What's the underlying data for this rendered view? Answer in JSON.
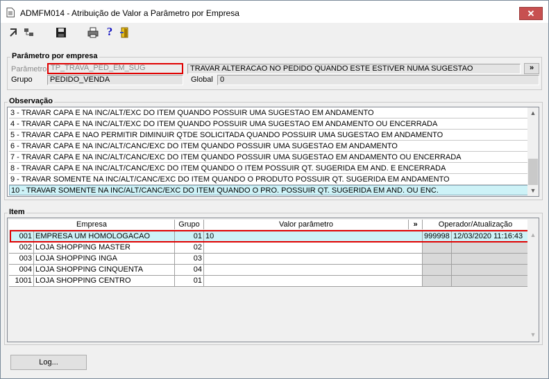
{
  "window": {
    "title": "ADMFM014 - Atribuição de Valor a Parâmetro por Empresa",
    "close_glyph": "✕"
  },
  "toolbar": {
    "icons": [
      "first-record-icon",
      "tree-icon",
      "save-icon",
      "print-icon",
      "help-icon",
      "exit-icon"
    ],
    "help_glyph": "?"
  },
  "param_group": {
    "title": "Parâmetro por empresa",
    "parametro_label": "Parâmetro",
    "parametro_value": "TP_TRAVA_PED_EM_SUG",
    "parametro_desc": "TRAVAR ALTERACAO NO PEDIDO QUANDO ESTE ESTIVER NUMA SUGESTAO",
    "expand_label": "»",
    "grupo_label": "Grupo",
    "grupo_value": "PEDIDO_VENDA",
    "global_label": "Global",
    "global_value": "0"
  },
  "observacao": {
    "title": "Observação",
    "rows": [
      "3 - TRAVAR CAPA E NA INC/ALT/EXC DO ITEM QUANDO POSSUIR UMA SUGESTAO EM ANDAMENTO",
      "4 - TRAVAR CAPA E NA INC/ALT/EXC DO ITEM QUANDO POSSUIR UMA SUGESTAO EM ANDAMENTO OU ENCERRADA",
      "5 - TRAVAR CAPA E NAO PERMITIR DIMINUIR QTDE SOLICITADA QUANDO POSSUIR UMA SUGESTAO EM ANDAMENTO",
      "6 - TRAVAR CAPA E NA INC/ALT/CANC/EXC DO ITEM QUANDO POSSUIR UMA SUGESTAO EM ANDAMENTO",
      "7 - TRAVAR CAPA E NA INC/ALT/CANC/EXC DO ITEM QUANDO POSSUIR UMA SUGESTAO EM ANDAMENTO OU ENCERRADA",
      "8 - TRAVAR CAPA E NA INC/ALT/CANC/EXC DO ITEM QUANDO O ITEM POSSUIR QT. SUGERIDA EM AND. E ENCERRADA",
      "9 - TRAVAR SOMENTE NA INC/ALT/CANC/EXC DO ITEM QUANDO O PRODUTO POSSUIR QT. SUGERIDA EM ANDAMENTO",
      "10 - TRAVAR SOMENTE NA INC/ALT/CANC/EXC DO ITEM QUANDO O PRO. POSSUIR QT. SUGERIDA EM AND. OU ENC."
    ]
  },
  "item": {
    "title": "Item",
    "headers": {
      "empresa": "Empresa",
      "grupo": "Grupo",
      "valor": "Valor parâmetro",
      "expand": "»",
      "operador": "Operador/Atualização"
    },
    "rows": [
      {
        "code": "001",
        "empresa": "EMPRESA UM  HOMOLOGACAO",
        "grupo": "01",
        "valor": "10",
        "operador": "999998",
        "data": "12/03/2020 11:16:43"
      },
      {
        "code": "002",
        "empresa": "LOJA SHOPPING MASTER",
        "grupo": "02",
        "valor": "",
        "operador": "",
        "data": ""
      },
      {
        "code": "003",
        "empresa": "LOJA SHOPPING INGA",
        "grupo": "03",
        "valor": "",
        "operador": "",
        "data": ""
      },
      {
        "code": "004",
        "empresa": "LOJA SHOPPING CINQUENTA",
        "grupo": "04",
        "valor": "",
        "operador": "",
        "data": ""
      },
      {
        "code": "1001",
        "empresa": "LOJA SHOPPING  CENTRO",
        "grupo": "01",
        "valor": "",
        "operador": "",
        "data": ""
      }
    ]
  },
  "footer": {
    "log_label": "Log..."
  }
}
